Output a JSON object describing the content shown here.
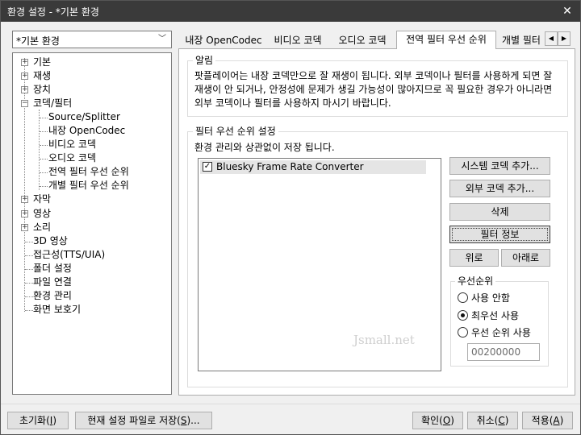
{
  "window": {
    "title": "환경 설정 - *기본 환경",
    "close_glyph": "✕"
  },
  "profile_combo": {
    "value": "*기본 환경",
    "arrow_glyph": "﹀"
  },
  "tree": {
    "items": [
      {
        "label": "기본",
        "expander": "+"
      },
      {
        "label": "재생",
        "expander": "+"
      },
      {
        "label": "장치",
        "expander": "+"
      },
      {
        "label": "코덱/필터",
        "expander": "−"
      },
      {
        "label": "Source/Splitter"
      },
      {
        "label": "내장 OpenCodec"
      },
      {
        "label": "비디오 코덱"
      },
      {
        "label": "오디오 코덱"
      },
      {
        "label": "전역 필터 우선 순위"
      },
      {
        "label": "개별 필터 우선 순위"
      },
      {
        "label": "자막",
        "expander": "+"
      },
      {
        "label": "영상",
        "expander": "+"
      },
      {
        "label": "소리",
        "expander": "+"
      },
      {
        "label": "3D 영상"
      },
      {
        "label": "접근성(TTS/UIA)"
      },
      {
        "label": "폴더 설정"
      },
      {
        "label": "파일 연결"
      },
      {
        "label": "환경 관리"
      },
      {
        "label": "화면 보호기"
      }
    ]
  },
  "tabs": {
    "items": [
      "내장 OpenCodec",
      "비디오 코덱",
      "오디오 코덱",
      "전역 필터 우선 순위",
      "개별 필터"
    ],
    "active_index": 3,
    "scroll_left": "◀",
    "scroll_right": "▶"
  },
  "notice": {
    "title": "알림",
    "text": "팟플레이어는 내장 코덱만으로 잘 재생이 됩니다. 외부 코덱이나 필터를 사용하게 되면 잘 재생이 안 되거나, 안정성에 문제가 생길 가능성이 많아지므로 꼭 필요한 경우가 아니라면 외부 코덱이나 필터를 사용하지 마시기 바랍니다."
  },
  "filter_priority": {
    "title": "필터 우선 순위 설정",
    "note": "환경 관리와 상관없이 저장 됩니다.",
    "list": [
      {
        "label": "Bluesky Frame Rate Converter",
        "checked": true,
        "check_glyph": "✓"
      }
    ],
    "buttons": {
      "add_system": "시스템 코덱 추가...",
      "add_external": "외부 코덱 추가...",
      "delete": "삭제",
      "filter_info": "필터 정보",
      "up": "위로",
      "down": "아래로"
    },
    "priority": {
      "title": "우선순위",
      "options": [
        "사용 안함",
        "최우선 사용",
        "우선 순위 사용"
      ],
      "selected_index": 1,
      "value": "00200000"
    },
    "watermark": "Jsmall.net"
  },
  "bottom": {
    "reset": {
      "text": "초기화(",
      "key": "I",
      "close": ")"
    },
    "save_as": {
      "text": "현재 설정 파일로 저장(",
      "key": "S",
      "close": ")..."
    },
    "ok": {
      "text": "확인(",
      "key": "O",
      "close": ")"
    },
    "cancel": {
      "text": "취소(",
      "key": "C",
      "close": ")"
    },
    "apply": {
      "text": "적용(",
      "key": "A",
      "close": ")"
    }
  }
}
